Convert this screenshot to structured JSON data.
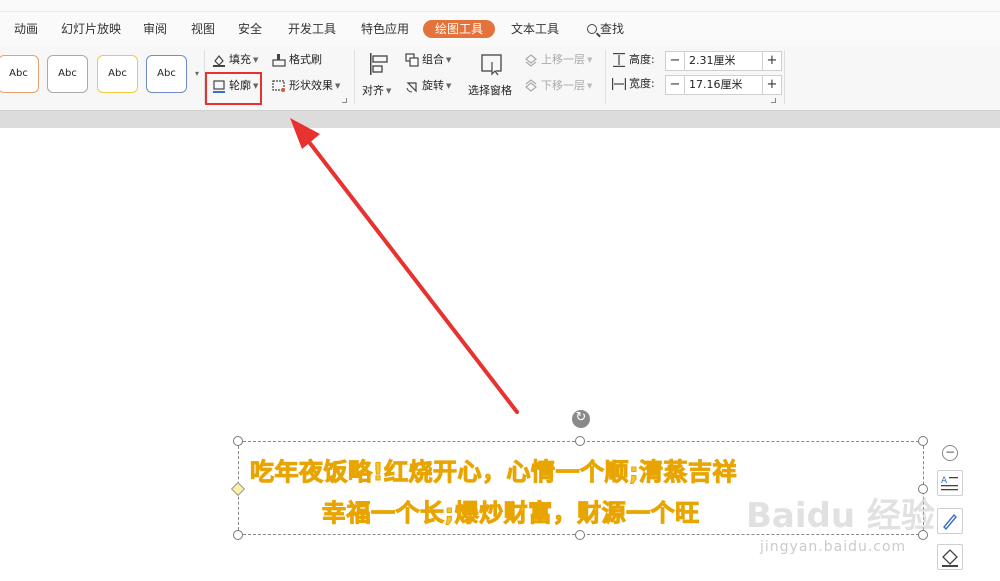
{
  "tabs": [
    {
      "label": "动画"
    },
    {
      "label": "幻灯片放映"
    },
    {
      "label": "审阅"
    },
    {
      "label": "视图"
    },
    {
      "label": "安全"
    },
    {
      "label": "开发工具"
    },
    {
      "label": "特色应用"
    },
    {
      "label": "绘图工具",
      "active": true
    },
    {
      "label": "文本工具"
    }
  ],
  "search_label": "查找",
  "style_gallery": [
    {
      "label": "Abc",
      "border": "#e8a070"
    },
    {
      "label": "Abc",
      "border": "#a9a9a9"
    },
    {
      "label": "Abc",
      "border": "#f2c93b"
    },
    {
      "label": "Abc",
      "border": "#6f8cc8"
    }
  ],
  "ribbon": {
    "fill": "填充",
    "format_painter": "格式刷",
    "outline": "轮廓",
    "shape_effects": "形状效果",
    "align": "对齐",
    "group": "组合",
    "rotate": "旋转",
    "selection_pane": "选择窗格",
    "bring_forward": "上移一层",
    "send_backward": "下移一层",
    "height_label": "高度:",
    "height_value": "2.31厘米",
    "width_label": "宽度:",
    "width_value": "17.16厘米"
  },
  "slide_text": {
    "line1": "吃年夜饭略!红烧开心，心情一个顺;清蒸吉祥",
    "line2": "幸福一个长;爆炒财富，财源一个旺"
  },
  "watermark": {
    "main": "Baidu 经验",
    "url": "jingyan.baidu.com"
  },
  "colors": {
    "accent": "#e4723b",
    "highlight": "#e8322f",
    "arrow": "#e8322f",
    "text_fill": "#f7c62f"
  }
}
